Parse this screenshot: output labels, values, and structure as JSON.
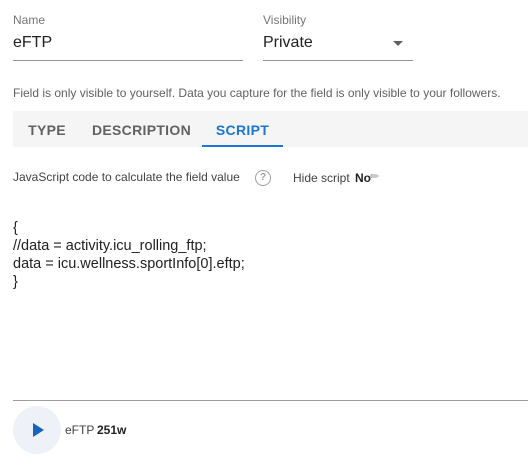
{
  "name_field": {
    "label": "Name",
    "value": "eFTP"
  },
  "visibility_field": {
    "label": "Visibility",
    "value": "Private"
  },
  "helper_text": "Field is only visible to yourself. Data you capture for the field is only visible to your followers.",
  "tabs": [
    {
      "label": "TYPE",
      "active": false
    },
    {
      "label": "DESCRIPTION",
      "active": false
    },
    {
      "label": "SCRIPT",
      "active": true
    }
  ],
  "script_section": {
    "label": "JavaScript code to calculate the field value",
    "help_icon": "?",
    "hide_script_label": "Hide script",
    "hide_script_value": "No",
    "edit_icon": "✏"
  },
  "code": {
    "lines": [
      "{",
      "//data = activity.icu_rolling_ftp;",
      "data = icu.wellness.sportInfo[0].eftp;",
      "}"
    ]
  },
  "result": {
    "label": "eFTP",
    "value": "251w"
  },
  "colors": {
    "accent": "#1976d2",
    "tab_bg": "#f5f5f5",
    "play_bg": "#eef2f8"
  }
}
